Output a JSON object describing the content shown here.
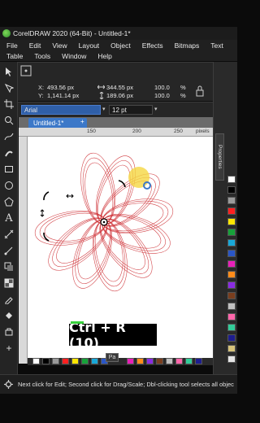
{
  "title_bar": {
    "text": "CorelDRAW 2020 (64-Bit) - Untitled-1*"
  },
  "menu_row1": [
    "File",
    "Edit",
    "View",
    "Layout",
    "Object",
    "Effects",
    "Bitmaps",
    "Text"
  ],
  "menu_row2": [
    "Table",
    "Tools",
    "Window",
    "Help"
  ],
  "property_bar": {
    "x_label": "X:",
    "x_value": "493.56 px",
    "y_label": "Y:",
    "y_value": "1,141.14 px",
    "w_value": "344.55 px",
    "h_value": "189.06 px",
    "scale_x": "100.0",
    "scale_y": "100.0",
    "scale_unit": "%"
  },
  "font_bar": {
    "font_name": "Arial",
    "font_size": "12 pt"
  },
  "document_tab": {
    "label": "Untitled-1*"
  },
  "ruler": {
    "labels": [
      "150",
      "200",
      "250"
    ],
    "unit": "pixels"
  },
  "docker_tab": {
    "label": "Properties"
  },
  "page_tab": {
    "label": "Pa"
  },
  "shortcut_overlay": {
    "text": "Ctrl + R (10)"
  },
  "status_bar": {
    "text": "Next click for Edit; Second click for Drag/Scale; Dbl-clicking tool selects all objec"
  },
  "colors": {
    "rosette_stroke": "#d0393e",
    "accent_blue": "#3c78c8",
    "highlight_yellow": "#f5d742",
    "shortcut_green": "#38d13c"
  },
  "palette_colors": [
    "#ffffff",
    "#000000",
    "#9a9a9a",
    "#ff2020",
    "#ffe600",
    "#17a23a",
    "#19a8d8",
    "#2a56c6",
    "#e820b8",
    "#ff8c1a",
    "#8a2be2",
    "#7a3e1e",
    "#c0c0c0",
    "#ff66aa",
    "#33cc99",
    "#1d1d8f",
    "#d6c37a",
    "#e5e5e5"
  ]
}
